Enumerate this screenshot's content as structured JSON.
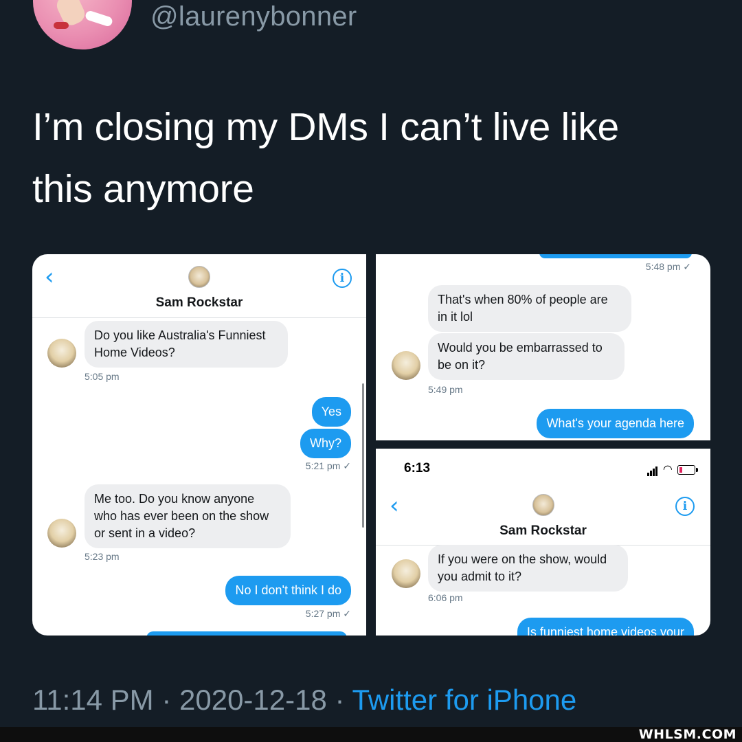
{
  "tweet": {
    "handle": "@laurenybonner",
    "text_line1": "I’m closing my DMs I can’t live like",
    "text_line2": "this anymore",
    "time": "11:14 PM",
    "date": "2020-12-18",
    "separator": "·",
    "source": "Twitter for iPhone"
  },
  "screenshot1": {
    "contact_name": "Sam Rockstar",
    "messages": [
      {
        "direction": "in",
        "text_line1": "Do you like Australia's Funniest",
        "text_line2": "Home Videos?",
        "time": "5:05 pm"
      },
      {
        "direction": "out",
        "text": "Yes"
      },
      {
        "direction": "out",
        "text": "Why?",
        "time": "5:21 pm ✓"
      },
      {
        "direction": "in",
        "text_line1": "Me too. Do you know anyone",
        "text_line2": "who has ever been on the show",
        "text_line3": "or sent in a video?",
        "time": "5:23 pm"
      },
      {
        "direction": "out",
        "text": "No I don't think I do",
        "time": "5:27 pm ✓"
      }
    ]
  },
  "screenshot2": {
    "top_time": "5:48 pm ✓",
    "messages": [
      {
        "direction": "in",
        "text_line1": "That's when 80% of people are",
        "text_line2": "in it lol"
      },
      {
        "direction": "in",
        "text_line1": "Would you be embarrassed to",
        "text_line2": "be on it?",
        "time": "5:49 pm"
      },
      {
        "direction": "out",
        "text": "What's your agenda here"
      }
    ]
  },
  "screenshot3": {
    "status_time": "6:13",
    "contact_name": "Sam Rockstar",
    "messages": [
      {
        "direction": "in",
        "text_line1": "If you were on the show, would",
        "text_line2": "you admit to it?",
        "time": "6:06 pm"
      },
      {
        "direction": "out",
        "text": "Is funniest home videos your"
      }
    ]
  },
  "watermark": "WHLSM.COM",
  "icons": {
    "back": "chevron-left-icon",
    "info": "info-circle-icon",
    "signal": "cellular-signal-icon",
    "wifi": "wifi-icon",
    "battery": "battery-low-icon"
  },
  "colors": {
    "background": "#141d26",
    "accent": "#1d9bf0",
    "muted_text": "#8899a6",
    "incoming_bubble": "#edeef0",
    "outgoing_bubble": "#1d9bf0"
  }
}
